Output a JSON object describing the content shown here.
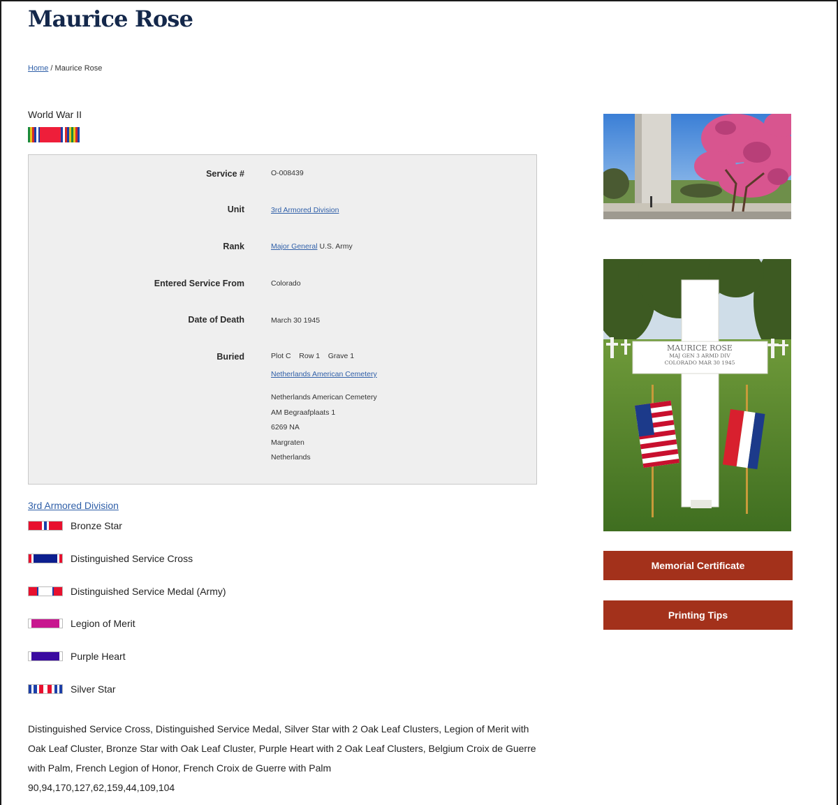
{
  "page_title": "Maurice Rose",
  "breadcrumb": {
    "home": "Home",
    "separator": "/",
    "current": "Maurice Rose"
  },
  "conflict": "World War II",
  "details": {
    "service_label": "Service #",
    "service_value": "O-008439",
    "unit_label": "Unit",
    "unit_value": "3rd Armored Division",
    "rank_label": "Rank",
    "rank_link": "Major General",
    "rank_branch": "U.S. Army",
    "entered_label": "Entered Service From",
    "entered_value": "Colorado",
    "death_label": "Date of Death",
    "death_value": "March 30 1945",
    "buried_label": "Buried",
    "plot_label": "Plot",
    "plot_value": "C",
    "row_label": "Row",
    "row_value": "1",
    "grave_label": "Grave",
    "grave_value": "1",
    "cemetery_link": "Netherlands American Cemetery",
    "address": [
      "Netherlands American Cemetery",
      "AM Begraafplaats 1",
      "6269 NA",
      "Margraten",
      "Netherlands"
    ]
  },
  "unit_link": "3rd Armored Division",
  "awards": [
    {
      "name": "Bronze Star",
      "icon": "bronze-star-ribbon"
    },
    {
      "name": "Distinguished Service Cross",
      "icon": "dsc-ribbon"
    },
    {
      "name": "Distinguished Service Medal (Army)",
      "icon": "dsm-ribbon"
    },
    {
      "name": "Legion of Merit",
      "icon": "legion-of-merit-ribbon"
    },
    {
      "name": "Purple Heart",
      "icon": "purple-heart-ribbon"
    },
    {
      "name": "Silver Star",
      "icon": "silver-star-ribbon"
    }
  ],
  "awards_text": "Distinguished Service Cross, Distinguished Service Medal, Silver Star with 2 Oak Leaf Clusters, Legion of Merit with Oak Leaf Cluster, Bronze Star with Oak Leaf Cluster, Purple Heart with 2 Oak Leaf Clusters, Belgium Croix de Guerre with Palm, French Legion of Honor, French Croix de Guerre with Palm",
  "award_codes": "90,94,170,127,62,159,44,109,104",
  "headstone": {
    "line1": "MAURICE ROSE",
    "line2": "MAJ GEN   3 ARMD DIV",
    "line3": "COLORADO   MAR 30 1945"
  },
  "buttons": {
    "certificate": "Memorial Certificate",
    "printing": "Printing Tips"
  },
  "colors": {
    "title": "#14284b",
    "link": "#2f5fa8",
    "button": "#a3311b",
    "box_bg": "#efefef"
  }
}
